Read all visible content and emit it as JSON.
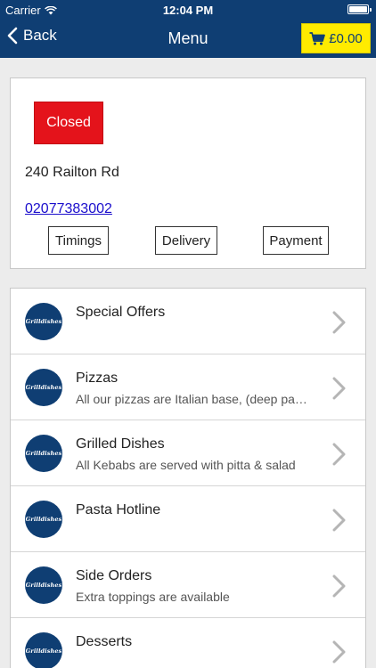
{
  "status_bar": {
    "carrier": "Carrier",
    "time": "12:04 PM"
  },
  "nav": {
    "back_label": "Back",
    "title": "Menu",
    "cart_total": "£0.00"
  },
  "restaurant": {
    "status": "Closed",
    "address": "240 Railton Rd",
    "phone": "02077383002",
    "buttons": {
      "timings": "Timings",
      "delivery": "Delivery",
      "payment": "Payment"
    }
  },
  "menu": {
    "logo_text": "Grilldishes",
    "items": [
      {
        "title": "Special Offers",
        "subtitle": ""
      },
      {
        "title": "Pizzas",
        "subtitle": "All our pizzas are Italian base, (deep pa…"
      },
      {
        "title": "Grilled Dishes",
        "subtitle": "All Kebabs are served with pitta & salad"
      },
      {
        "title": "Pasta Hotline",
        "subtitle": ""
      },
      {
        "title": "Side Orders",
        "subtitle": "Extra toppings are available"
      },
      {
        "title": "Desserts",
        "subtitle": ""
      }
    ]
  },
  "colors": {
    "nav_bg": "#0f3e73",
    "cart_bg": "#ffeb00",
    "closed_bg": "#e4131b",
    "link": "#1a0dcc"
  }
}
